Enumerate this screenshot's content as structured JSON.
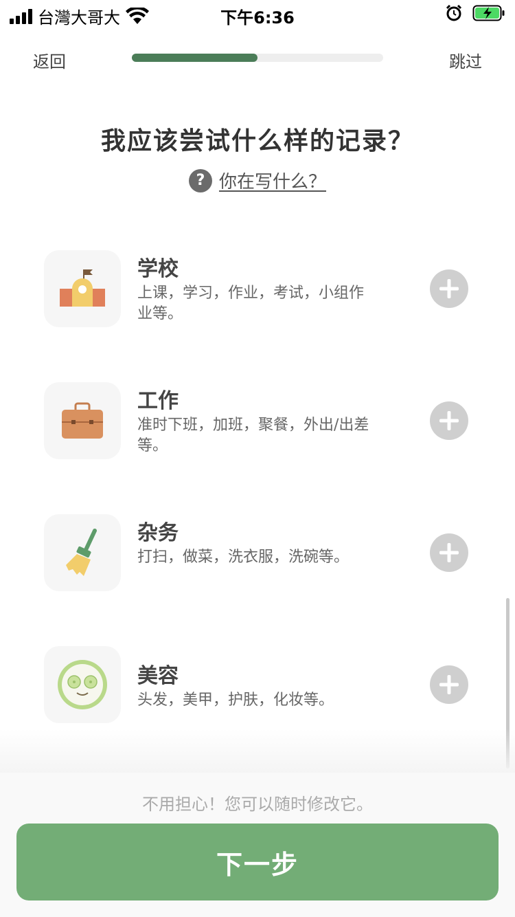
{
  "status_bar": {
    "carrier": "台灣大哥大",
    "time": "下午6:36"
  },
  "nav": {
    "back_label": "返回",
    "skip_label": "跳过",
    "progress": 0.5
  },
  "header": {
    "title": "我应该尝试什么样的记录？",
    "help_mark": "?",
    "help_link": "你在写什么？"
  },
  "categories": [
    {
      "title": "学校",
      "desc": "上课，学习，作业，考试，小组作业等。",
      "icon": "school-icon"
    },
    {
      "title": "工作",
      "desc": "准时下班，加班，聚餐，外出/出差等。",
      "icon": "briefcase-icon"
    },
    {
      "title": "杂务",
      "desc": "打扫，做菜，洗衣服，洗碗等。",
      "icon": "broom-icon"
    },
    {
      "title": "美容",
      "desc": "头发，美甲，护肤，化妆等。",
      "icon": "face-mask-icon"
    }
  ],
  "footer": {
    "reassure_text": "不用担心！您可以随时修改它。",
    "next_label": "下一步"
  },
  "colors": {
    "accent": "#73ad76",
    "progress": "#4b7d58",
    "add_button": "#cfcfcf"
  }
}
